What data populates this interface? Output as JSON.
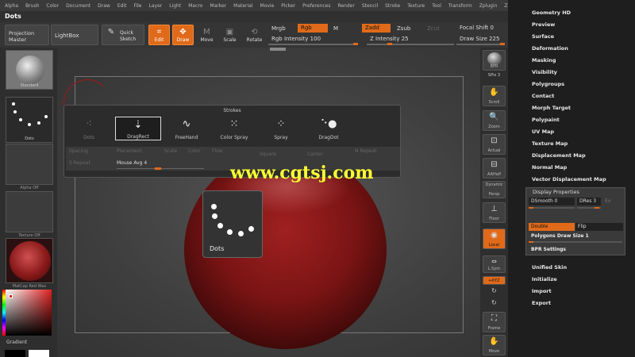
{
  "menu": [
    "Alpha",
    "Brush",
    "Color",
    "Document",
    "Draw",
    "Edit",
    "File",
    "Layer",
    "Light",
    "Macro",
    "Marker",
    "Material",
    "Movie",
    "Picker",
    "Preferences",
    "Render",
    "Stencil",
    "Stroke",
    "Texture",
    "Tool",
    "Transform",
    "Zplugin",
    "Zscript"
  ],
  "title": "Dots",
  "toolbar": {
    "projection_master": "Projection Master",
    "lightbox": "LightBox",
    "quick_sketch": "Quick Sketch",
    "edit": "Edit",
    "draw": "Draw",
    "move": "Move",
    "scale": "Scale",
    "rotate": "Rotate",
    "mrgb": "Mrgb",
    "rgb": "Rgb",
    "m": "M",
    "zadd": "Zadd",
    "zsub": "Zsub",
    "zcut": "Zcut",
    "rgb_intensity": "Rgb Intensity 100",
    "z_intensity": "Z Intensity 25",
    "focal_shift": "Focal Shift 0",
    "draw_size": "Draw Size 225"
  },
  "left_shelf": {
    "material_top": "Standard",
    "stroke": "Dots",
    "alpha": "Alpha Off",
    "texture": "Texture Off",
    "material": "MatCap Red Wax",
    "gradient": "Gradient"
  },
  "strokes": {
    "header": "Strokes",
    "options": [
      "Dots",
      "DragRect",
      "FreeHand",
      "Color Spray",
      "Spray",
      "DragDot"
    ],
    "row2": [
      "Spacing",
      "Placement",
      "Scale",
      "Color",
      "Flow",
      "Square",
      "Center",
      "N Repeat",
      "S Repeat",
      "Mouse Avg 4"
    ]
  },
  "tooltip": {
    "label": "Dots"
  },
  "watermark": "www.cgtsj.com",
  "right_shelf": {
    "bpr": "BPR",
    "spix": "SPix 3",
    "scroll": "Scroll",
    "zoom": "Zoom",
    "actual": "Actual",
    "aahalf": "AAHalf",
    "dynamic": "Dynamic",
    "persp": "Persp",
    "floor": "Floor",
    "local": "Local",
    "lsym": "L.Sym",
    "xyz": "↔XYZ",
    "frame": "Frame",
    "move": "Move"
  },
  "right_panel": {
    "items_top": [
      "Geometry HD",
      "Preview",
      "Surface",
      "Deformation",
      "Masking",
      "Visibility",
      "Polygroups",
      "Contact",
      "Morph Target",
      "Polypaint",
      "UV Map",
      "Texture Map",
      "Displacement Map",
      "Normal Map",
      "Vector Displacement Map"
    ],
    "display_properties": "Display Properties",
    "dsmooth": "DSmooth 0",
    "dres": "DRes 3",
    "ev": "Ev",
    "double": "Double",
    "flip": "Flip",
    "poly_draw_size": "Polygons Draw Size 1",
    "bpr_settings": "BPR Settings",
    "items_bottom": [
      "Unified Skin",
      "Initialize",
      "Import",
      "Export"
    ]
  }
}
